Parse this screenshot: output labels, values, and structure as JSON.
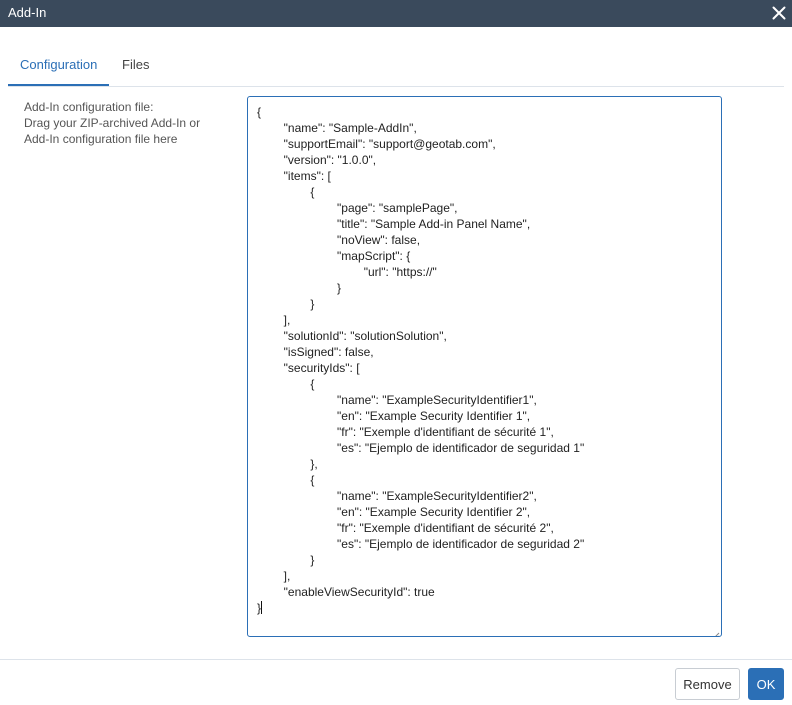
{
  "window": {
    "title": "Add-In"
  },
  "tabs": [
    {
      "label": "Configuration",
      "active": true
    },
    {
      "label": "Files",
      "active": false
    }
  ],
  "config_panel": {
    "label_lines": [
      "Add-In configuration file:",
      "Drag your ZIP-archived Add-In or",
      "Add-In configuration file here"
    ],
    "editor_lines": [
      "{",
      "        \"name\": \"Sample-AddIn\",",
      "        \"supportEmail\": \"support@geotab.com\",",
      "        \"version\": \"1.0.0\",",
      "        \"items\": [",
      "                {",
      "                        \"page\": \"samplePage\",",
      "                        \"title\": \"Sample Add-in Panel Name\",",
      "                        \"noView\": false,",
      "                        \"mapScript\": {",
      "                                \"url\": \"https://\"",
      "                        }",
      "                }",
      "        ],",
      "        \"solutionId\": \"solutionSolution\",",
      "        \"isSigned\": false,",
      "        \"securityIds\": [",
      "                {",
      "                        \"name\": \"ExampleSecurityIdentifier1\",",
      "                        \"en\": \"Example Security Identifier 1\",",
      "                        \"fr\": \"Exemple d'identifiant de sécurité 1\",",
      "                        \"es\": \"Ejemplo de identificador de seguridad 1\"",
      "                },",
      "                {",
      "                        \"name\": \"ExampleSecurityIdentifier2\",",
      "                        \"en\": \"Example Security Identifier 2\",",
      "                        \"fr\": \"Exemple d'identifiant de sécurité 2\",",
      "                        \"es\": \"Ejemplo de identificador de seguridad 2\"",
      "                }",
      "        ],",
      "        \"enableViewSecurityId\": true",
      "}"
    ]
  },
  "footer": {
    "remove_label": "Remove",
    "ok_label": "OK"
  },
  "icons": {
    "close": "close-icon",
    "resize": "resize-grip-icon"
  },
  "colors": {
    "titlebar": "#3a4a5c",
    "accent": "#2b6fb6"
  }
}
